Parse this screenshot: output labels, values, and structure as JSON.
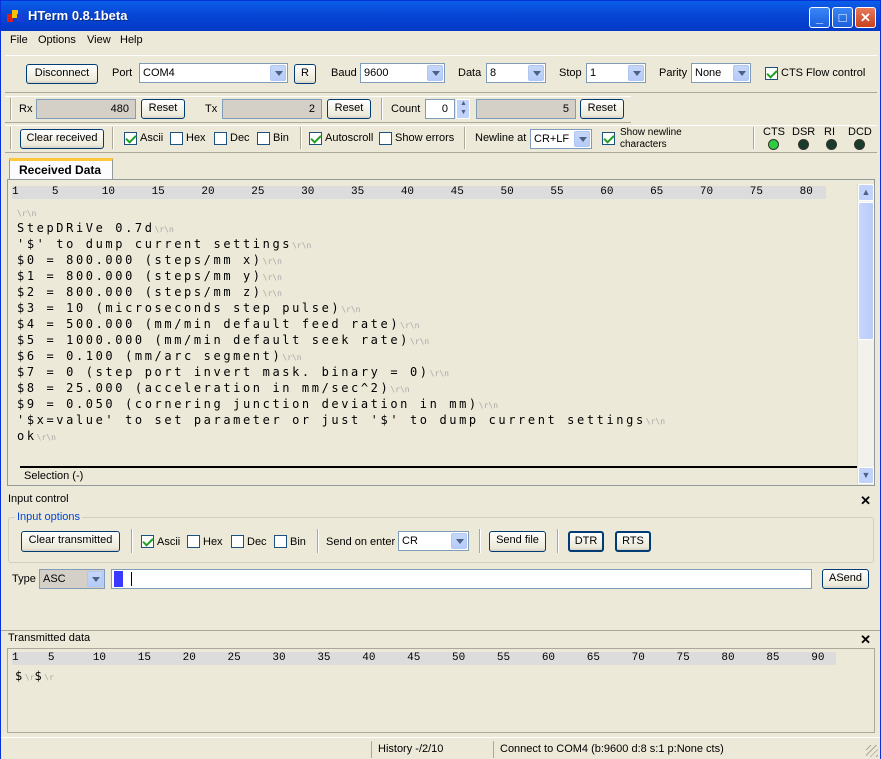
{
  "window": {
    "title": "HTerm 0.8.1beta",
    "minimize": "_",
    "maximize": "□",
    "close": "✕"
  },
  "menu": [
    "File",
    "Options",
    "View",
    "Help"
  ],
  "connection": {
    "disconnect_label": "Disconnect",
    "port_label": "Port",
    "port_value": "COM4",
    "refresh_label": "R",
    "baud_label": "Baud",
    "baud_value": "9600",
    "data_label": "Data",
    "data_value": "8",
    "stop_label": "Stop",
    "stop_value": "1",
    "parity_label": "Parity",
    "parity_value": "None",
    "cts_flow_label": "CTS Flow control",
    "cts_flow_checked": true
  },
  "counters": {
    "rx_label": "Rx",
    "rx_value": "480",
    "rx_reset": "Reset",
    "tx_label": "Tx",
    "tx_value": "2",
    "tx_reset": "Reset",
    "count_label": "Count",
    "count_value": "0",
    "count_total": "5",
    "count_reset": "Reset"
  },
  "receive_options": {
    "clear_label": "Clear received",
    "ascii": "Ascii",
    "hex": "Hex",
    "dec": "Dec",
    "bin": "Bin",
    "autoscroll": "Autoscroll",
    "show_errors": "Show errors",
    "newline_label": "Newline at",
    "newline_value": "CR+LF",
    "show_newline_1": "Show newline",
    "show_newline_2": "characters",
    "cts": "CTS",
    "dsr": "DSR",
    "ri": "RI",
    "dcd": "DCD",
    "led_colors": {
      "cts": "#2ecc40",
      "dsr": "#1a3a2a",
      "ri": "#1a3a2a",
      "dcd": "#1a3a2a"
    }
  },
  "received": {
    "tab": "Received Data",
    "ruler": [
      "1",
      "5",
      "10",
      "15",
      "20",
      "25",
      "30",
      "35",
      "40",
      "45",
      "50",
      "55",
      "60",
      "65",
      "70",
      "75",
      "80"
    ],
    "lines": [
      "",
      "StepDRiVe 0.7d",
      "'$' to dump current settings",
      "$0 = 800.000 (steps/mm x)",
      "$1 = 800.000 (steps/mm y)",
      "$2 = 800.000 (steps/mm z)",
      "$3 = 10 (microseconds step pulse)",
      "$4 = 500.000 (mm/min default feed rate)",
      "$5 = 1000.000 (mm/min default seek rate)",
      "$6 = 0.100 (mm/arc segment)",
      "$7 = 0 (step port invert mask. binary = 0)",
      "$8 = 25.000 (acceleration in mm/sec^2)",
      "$9 = 0.050 (cornering junction deviation in mm)",
      "'$x=value' to set parameter or just '$' to dump current settings",
      "ok"
    ],
    "eol_marker": "\\r\\n",
    "selection": "Selection (-)"
  },
  "input_control": {
    "header": "Input control",
    "group_label": "Input options",
    "clear_label": "Clear transmitted",
    "ascii": "Ascii",
    "hex": "Hex",
    "dec": "Dec",
    "bin": "Bin",
    "send_on_enter_label": "Send on enter",
    "send_on_enter_value": "CR",
    "send_file": "Send file",
    "dtr": "DTR",
    "rts": "RTS",
    "type_label": "Type",
    "type_value": "ASC",
    "asend": "ASend"
  },
  "transmitted": {
    "header": "Transmitted data",
    "ruler": [
      "1",
      "5",
      "10",
      "15",
      "20",
      "25",
      "30",
      "35",
      "40",
      "45",
      "50",
      "55",
      "60",
      "65",
      "70",
      "75",
      "80",
      "85",
      "90"
    ],
    "content": "$",
    "eol_marker": "\\r"
  },
  "statusbar": {
    "history": "History -/2/10",
    "connection": "Connect to COM4 (b:9600 d:8 s:1 p:None cts)"
  }
}
